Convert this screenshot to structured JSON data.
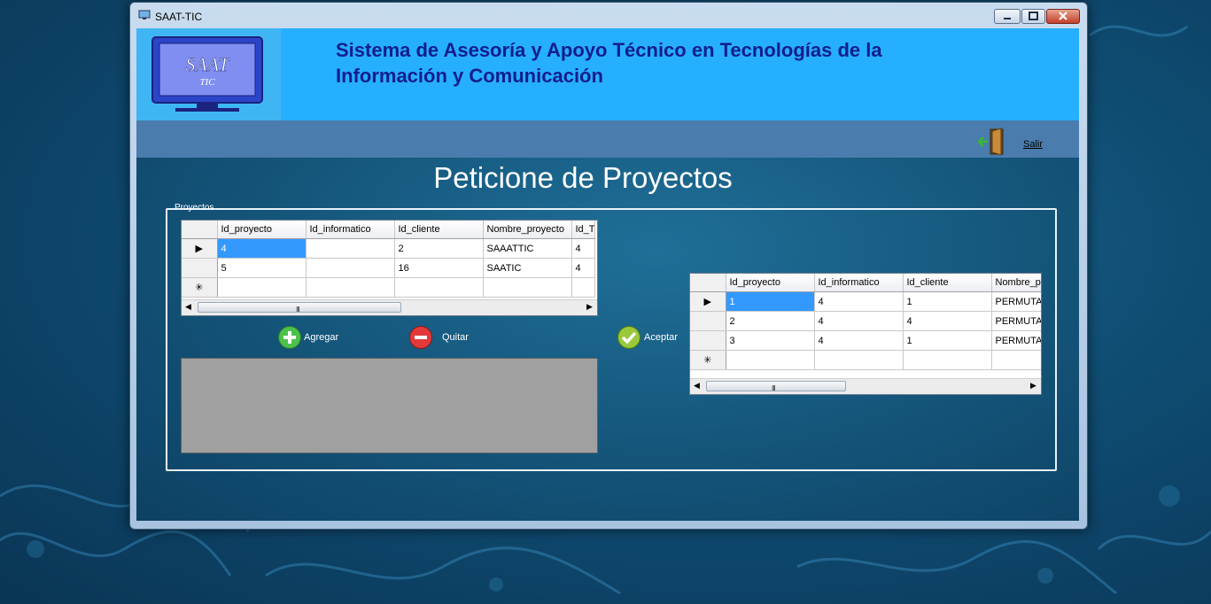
{
  "window": {
    "title": "SAAT-TIC",
    "buttons": {
      "minimize": "minimize",
      "maximize": "maximize",
      "close": "close"
    }
  },
  "header": {
    "logo_text": "SAAT",
    "logo_subtext": "TIC",
    "app_title": "Sistema de Asesoría y Apoyo Técnico en Tecnologías de la Información y Comunicación"
  },
  "toolbar": {
    "exit_label": "Salir",
    "exit_icon": "door-exit-icon"
  },
  "page": {
    "heading": "Peticione de Proyectos"
  },
  "group": {
    "legend": "Proyectos"
  },
  "grid_left": {
    "columns": [
      "Id_proyecto",
      "Id_informatico",
      "Id_cliente",
      "Nombre_proyecto",
      "Id_T"
    ],
    "rows": [
      [
        "4",
        "",
        "2",
        "SAAATTIC",
        "4"
      ],
      [
        "5",
        "",
        "16",
        "SAATIC",
        "4"
      ]
    ],
    "scroll_grip": "III"
  },
  "grid_right": {
    "columns": [
      "Id_proyecto",
      "Id_informatico",
      "Id_cliente",
      "Nombre_p"
    ],
    "rows": [
      [
        "1",
        "4",
        "1",
        "PERMUTA"
      ],
      [
        "2",
        "4",
        "4",
        "PERMUTA"
      ],
      [
        "3",
        "4",
        "1",
        "PERMUTA"
      ]
    ],
    "scroll_grip": "III"
  },
  "actions": {
    "add_label": "Agregar",
    "remove_label": "Quitar",
    "accept_label": "Aceptar"
  },
  "colors": {
    "header_bg": "#26afff",
    "title_text": "#121e8c",
    "toolbar_bg": "#4a7cad",
    "selection": "#3399ff"
  }
}
